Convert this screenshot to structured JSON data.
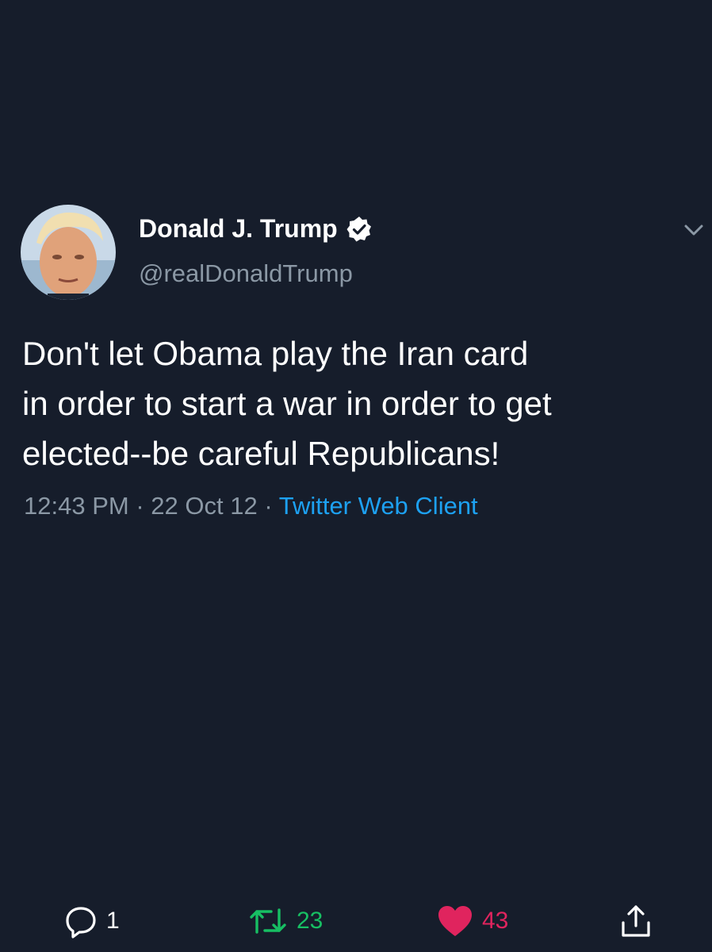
{
  "tweet": {
    "display_name": "Donald J. Trump",
    "handle": "@realDonaldTrump",
    "text_lines": [
      "Don't let Obama play the Iran card",
      "in order to start a war in order to get",
      "elected--be careful Republicans!"
    ],
    "time": "12:43 PM",
    "separator": "·",
    "date": "22 Oct 12",
    "source": "Twitter Web Client"
  },
  "actions": {
    "replies": "1",
    "retweets": "23",
    "likes": "43"
  },
  "icons": {
    "verified": "verified-badge-icon",
    "menu": "chevron-down-icon",
    "reply": "reply-icon",
    "retweet": "retweet-icon",
    "like": "heart-icon",
    "share": "share-icon"
  },
  "colors": {
    "background": "#161d2b",
    "link": "#1da1f2",
    "retweet": "#17bf63",
    "like": "#e0245e",
    "muted": "#8b98a5"
  }
}
